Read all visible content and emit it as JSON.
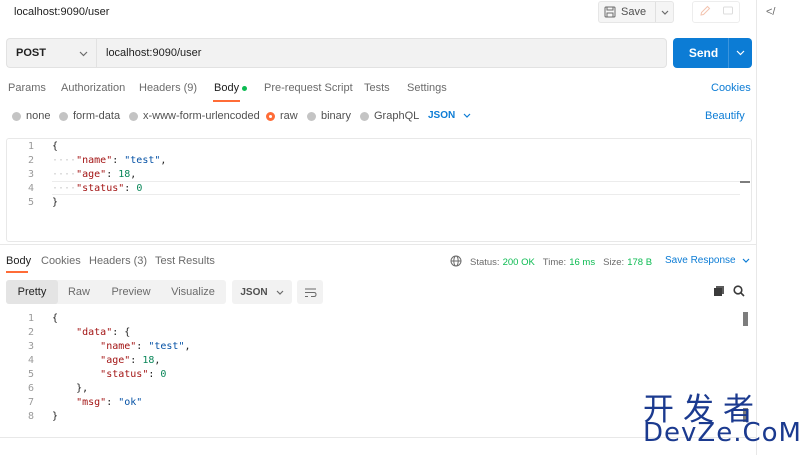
{
  "window": {
    "title": "localhost:9090/user"
  },
  "toolbar": {
    "save_label": "Save",
    "code_icon_text": "</"
  },
  "request": {
    "method": "POST",
    "url": "localhost:9090/user",
    "send_label": "Send"
  },
  "request_tabs": {
    "params": "Params",
    "authorization": "Authorization",
    "headers": "Headers (9)",
    "body": "Body",
    "prerequest": "Pre-request Script",
    "tests": "Tests",
    "settings": "Settings",
    "cookies": "Cookies",
    "active": "Body"
  },
  "body_types": {
    "none": "none",
    "form_data": "form-data",
    "urlencoded": "x-www-form-urlencoded",
    "raw": "raw",
    "binary": "binary",
    "graphql": "GraphQL",
    "selected": "raw",
    "format": "JSON",
    "beautify": "Beautify"
  },
  "request_body": {
    "line_numbers": [
      "1",
      "2",
      "3",
      "4",
      "5"
    ],
    "lines": [
      {
        "pre": "",
        "key": "",
        "mid": "{",
        "val": "",
        "post": ""
      },
      {
        "pre": "····",
        "key": "\"name\"",
        "mid": ": ",
        "val": "\"test\"",
        "post": ","
      },
      {
        "pre": "····",
        "key": "\"age\"",
        "mid": ": ",
        "val": "18",
        "post": ","
      },
      {
        "pre": "····",
        "key": "\"status\"",
        "mid": ": ",
        "val": "0",
        "post": ""
      },
      {
        "pre": "",
        "key": "",
        "mid": "}",
        "val": "",
        "post": ""
      }
    ]
  },
  "response_tabs": {
    "body": "Body",
    "cookies": "Cookies",
    "headers": "Headers (3)",
    "test_results": "Test Results"
  },
  "response_status": {
    "status_label": "Status:",
    "status_value": "200 OK",
    "time_label": "Time:",
    "time_value": "16 ms",
    "size_label": "Size:",
    "size_value": "178 B",
    "save_response": "Save Response"
  },
  "response_view": {
    "pretty": "Pretty",
    "raw": "Raw",
    "preview": "Preview",
    "visualize": "Visualize",
    "format": "JSON"
  },
  "response_body": {
    "line_numbers": [
      "1",
      "2",
      "3",
      "4",
      "5",
      "6",
      "7",
      "8"
    ],
    "lines": [
      {
        "pre": "",
        "key": "",
        "mid": "{",
        "val": "",
        "post": ""
      },
      {
        "pre": "    ",
        "key": "\"data\"",
        "mid": ": {",
        "val": "",
        "post": ""
      },
      {
        "pre": "        ",
        "key": "\"name\"",
        "mid": ": ",
        "val": "\"test\"",
        "post": ","
      },
      {
        "pre": "        ",
        "key": "\"age\"",
        "mid": ": ",
        "val": "18",
        "post": ","
      },
      {
        "pre": "        ",
        "key": "\"status\"",
        "mid": ": ",
        "val": "0",
        "post": ""
      },
      {
        "pre": "    ",
        "key": "",
        "mid": "},",
        "val": "",
        "post": ""
      },
      {
        "pre": "    ",
        "key": "\"msg\"",
        "mid": ": ",
        "val": "\"ok\"",
        "post": ""
      },
      {
        "pre": "",
        "key": "",
        "mid": "}",
        "val": "",
        "post": ""
      }
    ]
  },
  "watermark": {
    "cn": "开发者",
    "en": "DevZe.CoM"
  },
  "colors": {
    "accent": "#ff6c37",
    "primary": "#0c7cd5",
    "success": "#0cbb52",
    "watermark": "#1b3a8f"
  }
}
